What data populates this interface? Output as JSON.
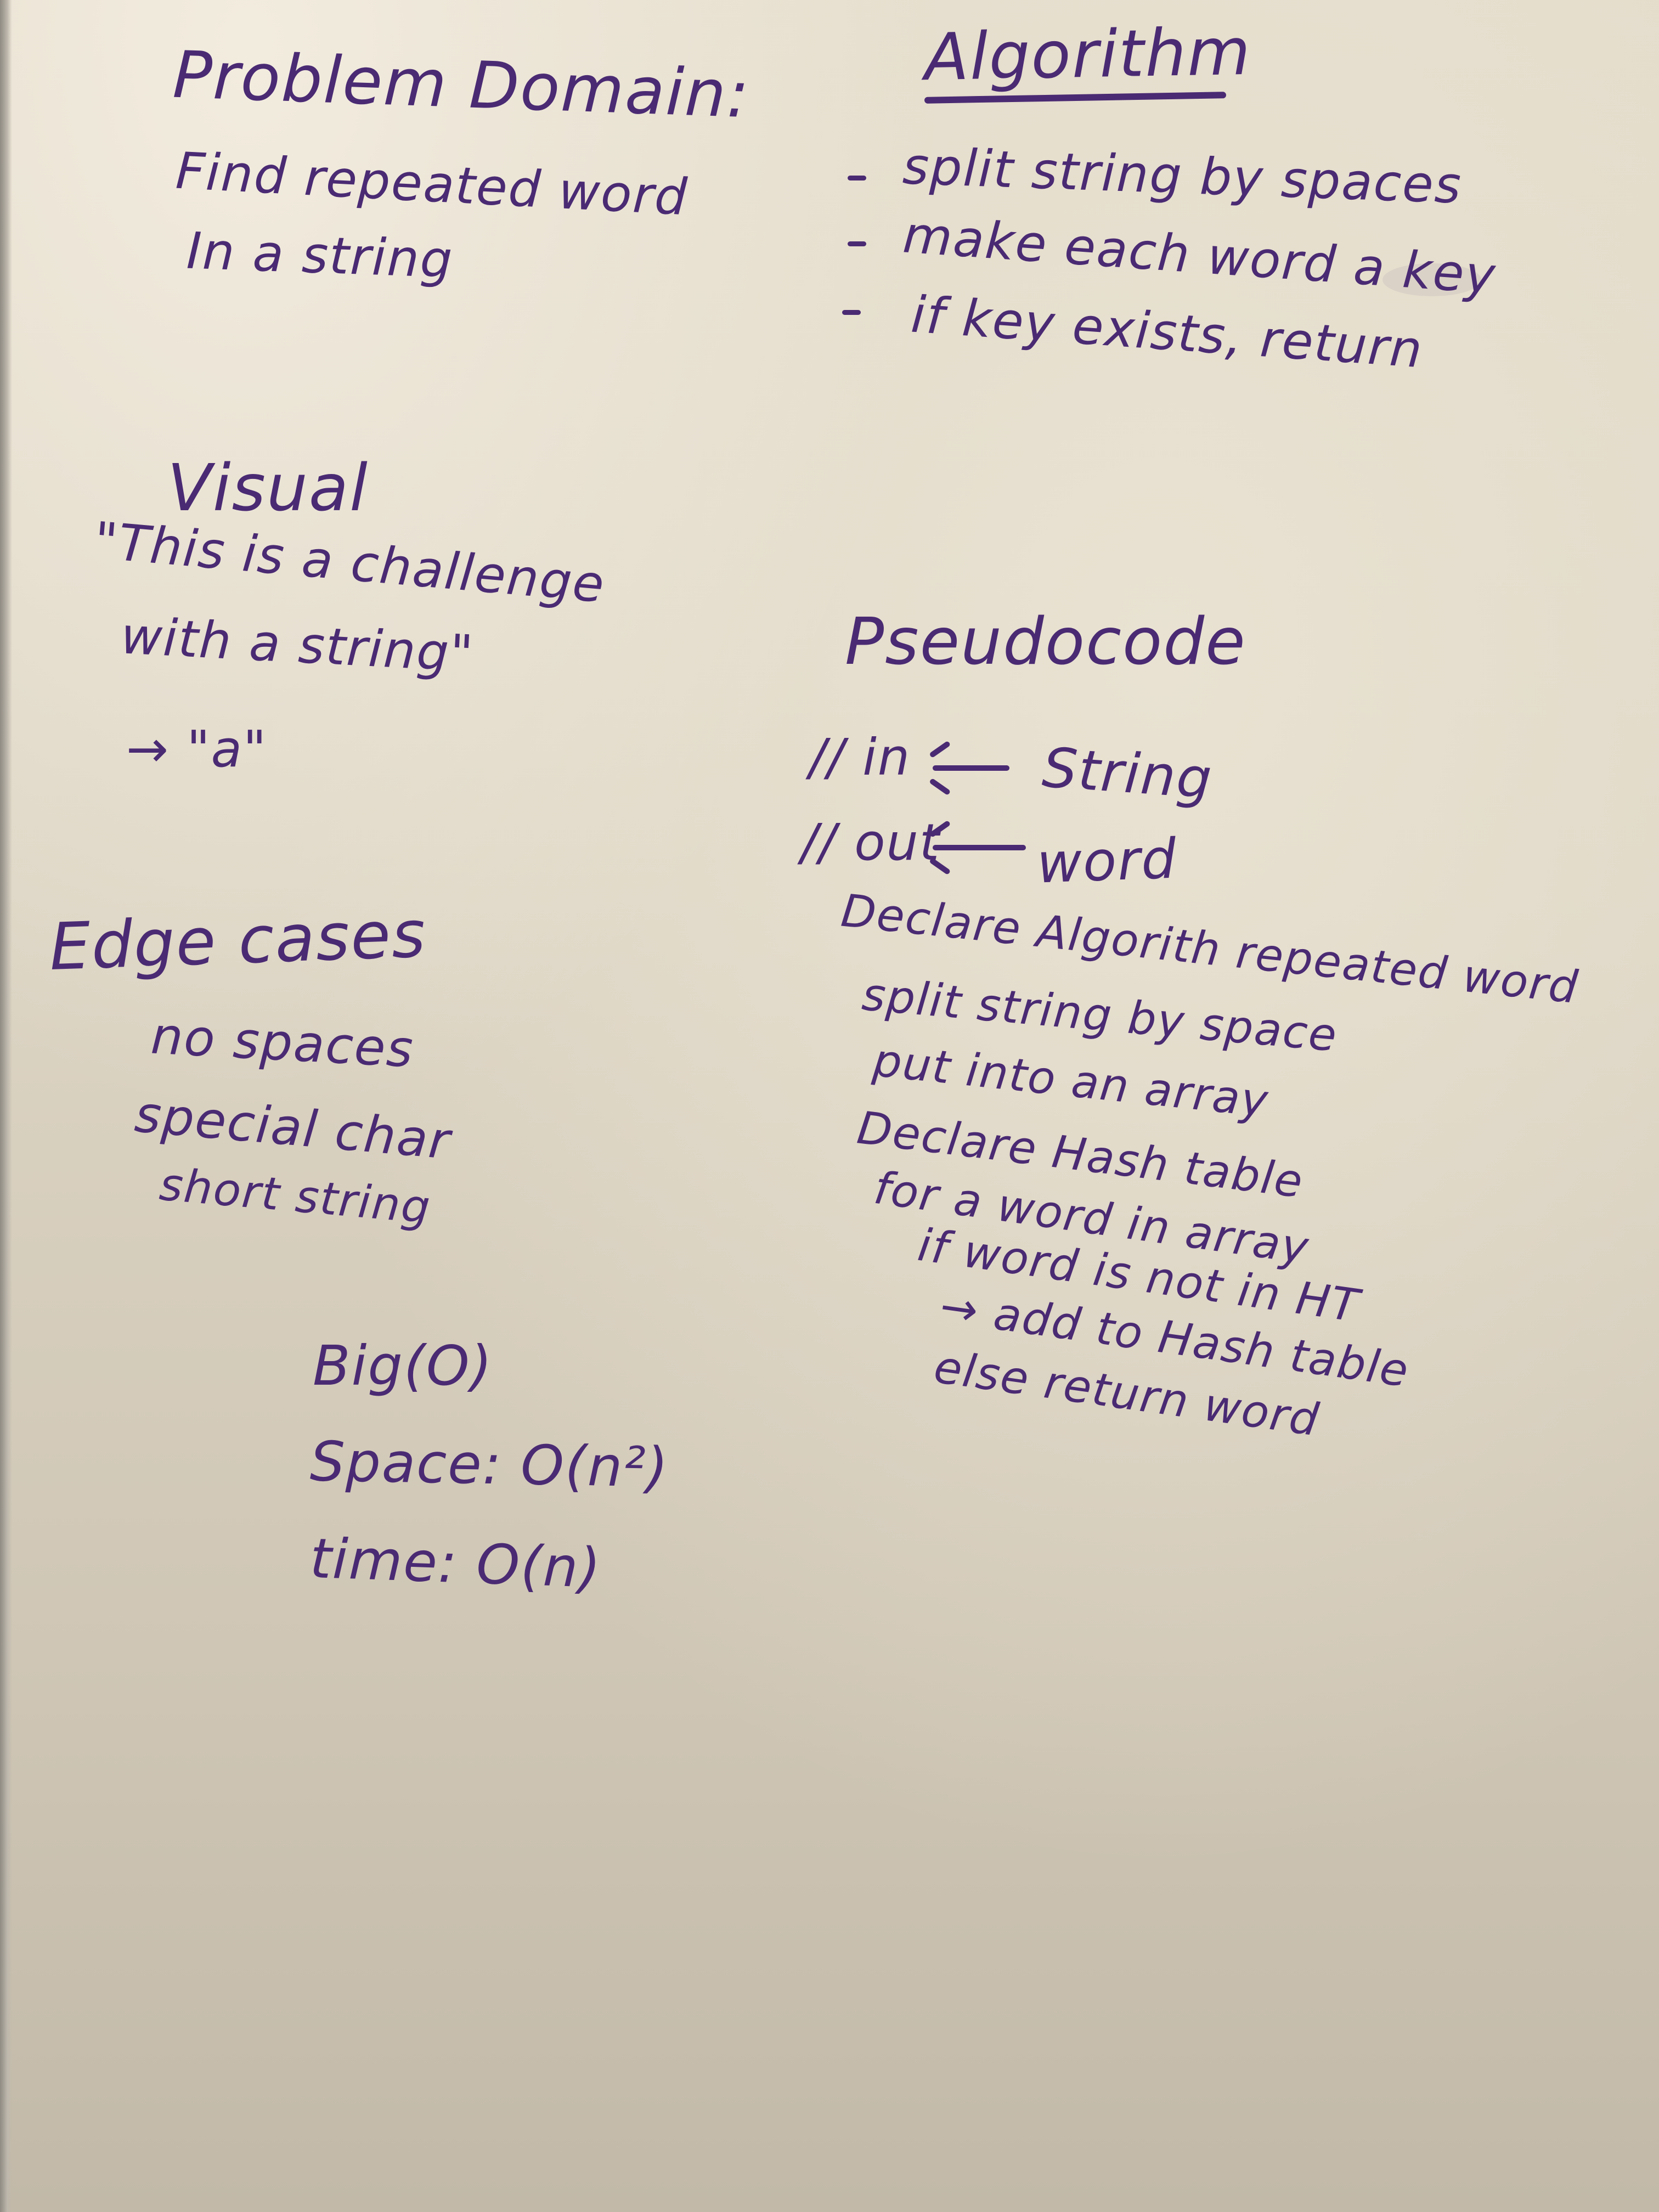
{
  "problem_domain": {
    "heading": "Problem Domain:",
    "line1": "Find repeated word",
    "line2": "In a string"
  },
  "algorithm": {
    "heading": "Algorithm",
    "steps": [
      "split string by spaces",
      "make each word a key",
      "if key exists, return"
    ]
  },
  "visual": {
    "heading": "Visual",
    "example_line1": "\"This is a challenge",
    "example_line2": "with a string\"",
    "result": "→ \"a\""
  },
  "pseudocode": {
    "heading": "Pseudocode",
    "in_label": "// in",
    "in_value": "String",
    "out_label": "// out",
    "out_value": "word",
    "lines": [
      "Declare Algorith repeated word",
      "split string by space",
      "put into an array",
      "Declare Hash table",
      "for a word in array",
      "if word is not in HT",
      "→ add to Hash table",
      "else return word"
    ]
  },
  "edge_cases": {
    "heading": "Edge cases",
    "items": [
      "no spaces",
      "special char",
      "short string"
    ]
  },
  "big_o": {
    "heading": "Big(O)",
    "space": "Space: O(n²)",
    "time": "time: O(n)"
  },
  "colors": {
    "ink": "#4a2a73",
    "board": "#ddd5c4"
  }
}
